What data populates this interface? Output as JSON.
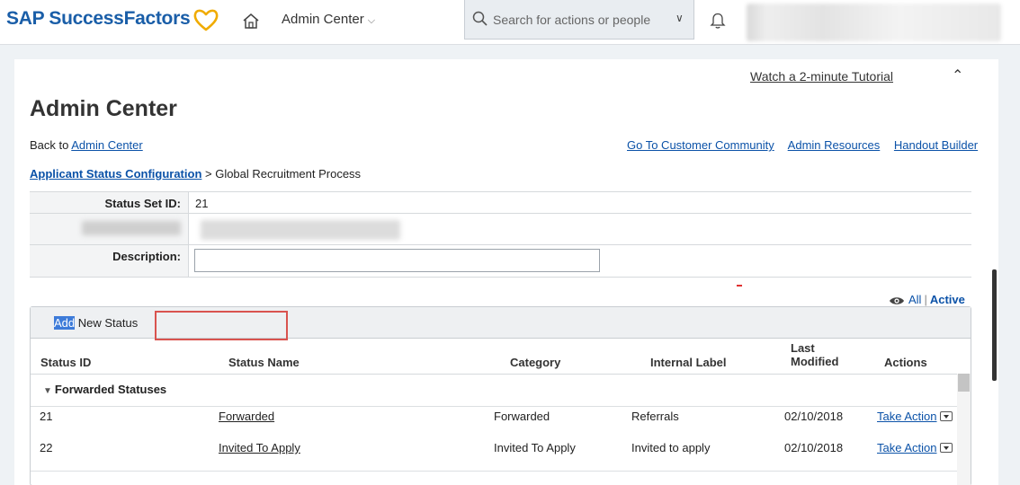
{
  "header": {
    "brand": "SAP SuccessFactors",
    "nav_menu": "Admin Center",
    "search_placeholder": "Search for actions or people"
  },
  "page": {
    "tutorial_link": "Watch a 2-minute Tutorial",
    "title": "Admin Center",
    "back_prefix": "Back to ",
    "back_link": "Admin Center",
    "links": [
      "Go To Customer Community",
      "Admin Resources",
      "Handout Builder"
    ],
    "breadcrumb_link": "Applicant Status Configuration",
    "breadcrumb_rest": " > Global Recruitment Process"
  },
  "form": {
    "status_set_id_label": "Status Set ID:",
    "status_set_id_value": "21",
    "description_label": "Description:",
    "description_value": ""
  },
  "view_toggle": {
    "all": "All",
    "separator": "|",
    "active": "Active"
  },
  "grid": {
    "add_highlight": "Add",
    "add_rest": " New Status",
    "columns": {
      "status_id": "Status ID",
      "status_name": "Status Name",
      "category": "Category",
      "internal_label": "Internal Label",
      "last_modified_1": "Last",
      "last_modified_2": "Modified",
      "actions": "Actions"
    },
    "group": "Forwarded Statuses",
    "rows": [
      {
        "id": "21",
        "name": "Forwarded",
        "category": "Forwarded",
        "label": "Referrals",
        "modified": "02/10/2018",
        "action": "Take Action"
      },
      {
        "id": "22",
        "name": "Invited To Apply",
        "category": "Invited To Apply",
        "label": "Invited to apply",
        "modified": "02/10/2018",
        "action": "Take Action"
      }
    ]
  },
  "colors": {
    "brand": "#1a5ea8",
    "heart": "#f0ab00",
    "link": "#0b52a8",
    "highlight": "#3d7bd9",
    "annotation_box": "#d9534f"
  }
}
